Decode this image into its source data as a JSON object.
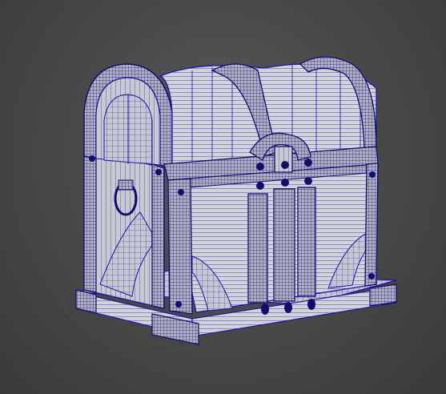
{
  "viewport": {
    "object_name": "treasure-chest",
    "display_mode": "wireframe",
    "colors": {
      "background": "#4a4a4a",
      "wire": "#1f17a6",
      "wire_dark": "#120d6b",
      "face_light": "#d7d8dc",
      "face_mid": "#b8b9bf",
      "face_dark": "#8d8e96",
      "shadow": "#6b6c74"
    }
  }
}
